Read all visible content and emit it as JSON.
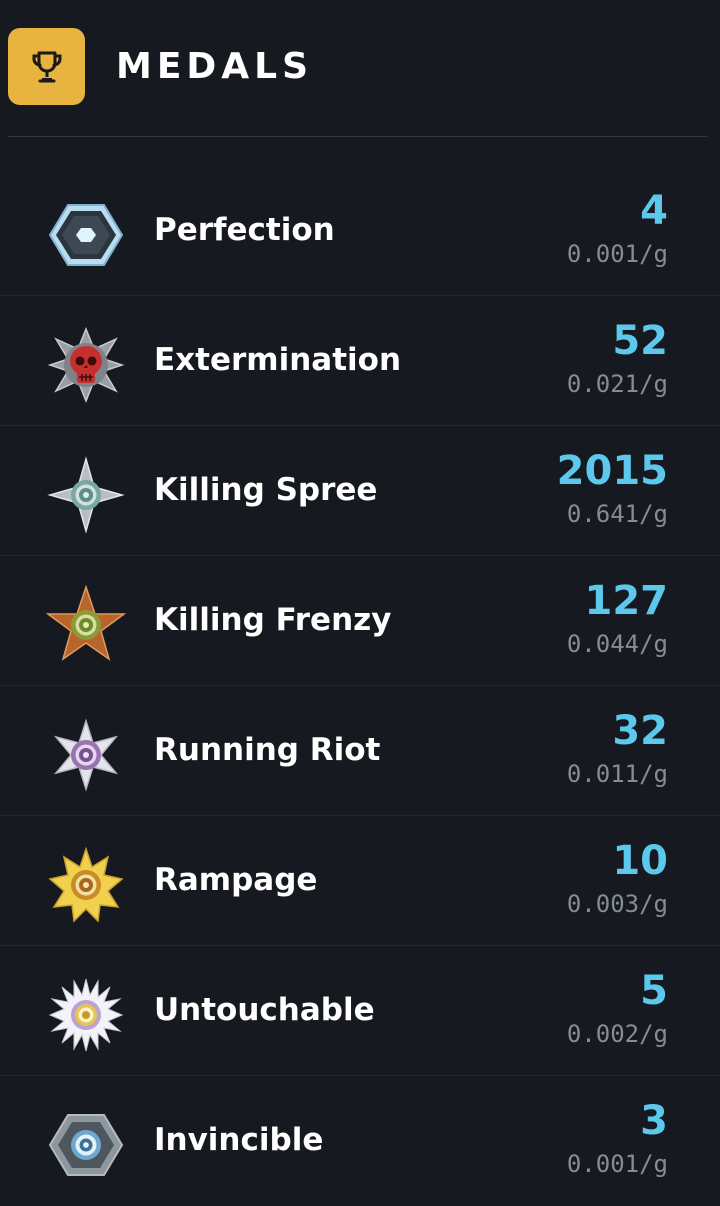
{
  "header": {
    "title": "MEDALS",
    "icon": "trophy-icon",
    "accent": "#e8b33e"
  },
  "colors": {
    "background": "#161a20",
    "count": "#5cc9ec",
    "rate": "#858c96"
  },
  "medals": [
    {
      "name": "Perfection",
      "count": "4",
      "rate": "0.001/g",
      "icon": "perfection-medal-icon"
    },
    {
      "name": "Extermination",
      "count": "52",
      "rate": "0.021/g",
      "icon": "extermination-medal-icon"
    },
    {
      "name": "Killing Spree",
      "count": "2015",
      "rate": "0.641/g",
      "icon": "killing-spree-medal-icon"
    },
    {
      "name": "Killing Frenzy",
      "count": "127",
      "rate": "0.044/g",
      "icon": "killing-frenzy-medal-icon"
    },
    {
      "name": "Running Riot",
      "count": "32",
      "rate": "0.011/g",
      "icon": "running-riot-medal-icon"
    },
    {
      "name": "Rampage",
      "count": "10",
      "rate": "0.003/g",
      "icon": "rampage-medal-icon"
    },
    {
      "name": "Untouchable",
      "count": "5",
      "rate": "0.002/g",
      "icon": "untouchable-medal-icon"
    },
    {
      "name": "Invincible",
      "count": "3",
      "rate": "0.001/g",
      "icon": "invincible-medal-icon"
    }
  ]
}
